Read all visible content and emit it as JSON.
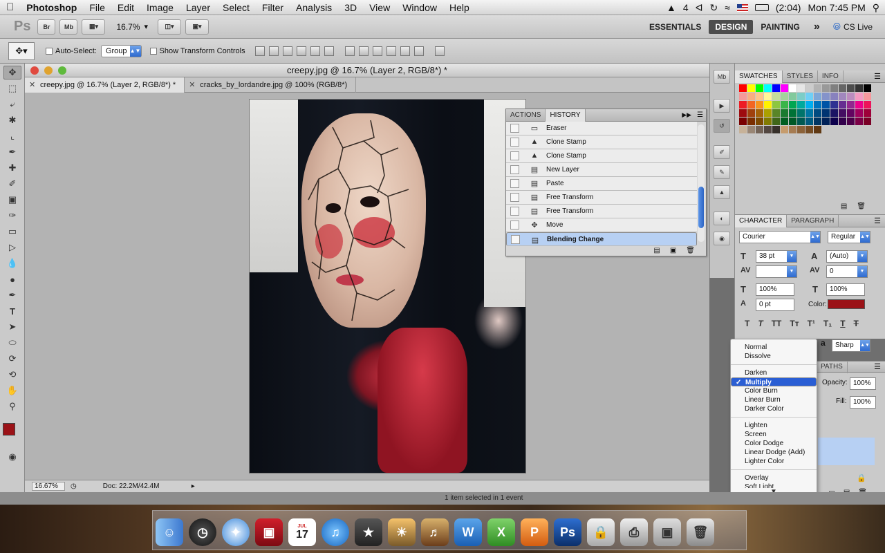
{
  "menubar": {
    "apple": "",
    "app": "Photoshop",
    "items": [
      "File",
      "Edit",
      "Image",
      "Layer",
      "Select",
      "Filter",
      "Analysis",
      "3D",
      "View",
      "Window",
      "Help"
    ],
    "right": {
      "ai": "4",
      "battery": "(2:04)",
      "clock": "Mon 7:45 PM"
    }
  },
  "appbar": {
    "logo": "Ps",
    "br": "Br",
    "mb": "Mb",
    "zoom": "16.7%",
    "workspaces": [
      "ESSENTIALS",
      "DESIGN",
      "PAINTING"
    ],
    "active_workspace": "DESIGN",
    "more": "»",
    "cslive": "CS Live"
  },
  "options": {
    "auto_select_label": "Auto-Select:",
    "auto_select_value": "Group",
    "show_transform": "Show Transform Controls"
  },
  "document": {
    "window_title": "creepy.jpg @ 16.7% (Layer 2, RGB/8*) *",
    "tabs": [
      {
        "label": "creepy.jpg @ 16.7% (Layer 2, RGB/8*) *"
      },
      {
        "label": "cracks_by_lordandre.jpg @ 100% (RGB/8*)"
      }
    ],
    "status_zoom": "16.67%",
    "status_doc": "Doc: 22.2M/42.4M",
    "strip_text": "1 item selected in 1 event"
  },
  "history": {
    "tabs": [
      "ACTIONS",
      "HISTORY"
    ],
    "active_tab": "HISTORY",
    "rows": [
      {
        "label": "Eraser",
        "icon": "eraser-icon"
      },
      {
        "label": "Clone Stamp",
        "icon": "stamp-icon"
      },
      {
        "label": "Clone Stamp",
        "icon": "stamp-icon"
      },
      {
        "label": "New Layer",
        "icon": "doc-icon"
      },
      {
        "label": "Paste",
        "icon": "doc-icon"
      },
      {
        "label": "Free Transform",
        "icon": "doc-icon"
      },
      {
        "label": "Free Transform",
        "icon": "doc-icon"
      },
      {
        "label": "Move",
        "icon": "move-icon"
      },
      {
        "label": "Blending Change",
        "icon": "doc-icon"
      }
    ],
    "selected_index": 8
  },
  "swatches": {
    "tabs": [
      "SWATCHES",
      "STYLES",
      "INFO"
    ],
    "colors": [
      "#ff0000",
      "#ffff00",
      "#00ff00",
      "#00ffff",
      "#0000ff",
      "#ff00ff",
      "#ffffff",
      "#e6e6e6",
      "#cccccc",
      "#b3b3b3",
      "#999999",
      "#808080",
      "#666666",
      "#4d4d4d",
      "#333333",
      "#000000",
      "#f5999a",
      "#f9ad81",
      "#fdc68a",
      "#fff799",
      "#c4df9b",
      "#a3d39c",
      "#82ca9d",
      "#7bcdc8",
      "#6ecff6",
      "#7ea7d8",
      "#8493ca",
      "#8882be",
      "#a187be",
      "#bc8cbf",
      "#f49ac2",
      "#f6989d",
      "#ed1c24",
      "#f26522",
      "#f7941d",
      "#fff200",
      "#8dc63f",
      "#39b54a",
      "#00a651",
      "#00a99d",
      "#00aeef",
      "#0072bc",
      "#0054a6",
      "#2e3192",
      "#662d91",
      "#92278f",
      "#ec008c",
      "#ed145b",
      "#9e0b0f",
      "#a0410d",
      "#a36209",
      "#aba000",
      "#598527",
      "#197b30",
      "#007236",
      "#00746b",
      "#0076a3",
      "#004b80",
      "#003471",
      "#1b1464",
      "#440e62",
      "#630460",
      "#9e005d",
      "#9e0039",
      "#790000",
      "#7b2e00",
      "#7d4900",
      "#827b00",
      "#406618",
      "#005e20",
      "#005826",
      "#005952",
      "#005b7f",
      "#003663",
      "#002157",
      "#0d004c",
      "#32004b",
      "#4b0049",
      "#7b0046",
      "#7a0026",
      "#c7b299",
      "#998675",
      "#736357",
      "#534741",
      "#37302a",
      "#c69c6d",
      "#a67c52",
      "#8c6239",
      "#754c24",
      "#603913"
    ]
  },
  "character": {
    "tabs": [
      "CHARACTER",
      "PARAGRAPH"
    ],
    "font_family": "Courier",
    "font_style": "Regular",
    "size": "38 pt",
    "leading": "(Auto)",
    "kerning": "",
    "tracking": "0",
    "vscale": "100%",
    "hscale": "100%",
    "baseline": "0 pt",
    "color_label": "Color:",
    "color": "#9b1217",
    "aa_label": "a",
    "aa_value": "Sharp"
  },
  "layers": {
    "tab": "PATHS",
    "opacity_label": "Opacity:",
    "opacity": "100%",
    "fill_label": "Fill:",
    "fill": "100%"
  },
  "blend_menu": {
    "groups": [
      [
        "Normal",
        "Dissolve"
      ],
      [
        "Darken",
        "Multiply",
        "Color Burn",
        "Linear Burn",
        "Darker Color"
      ],
      [
        "Lighten",
        "Screen",
        "Color Dodge",
        "Linear Dodge (Add)",
        "Lighter Color"
      ],
      [
        "Overlay",
        "Soft Light"
      ]
    ],
    "selected": "Multiply"
  },
  "foreground_color": "#9b1217",
  "dock": {
    "ps_label": "Ps",
    "cal_day": "17",
    "cal_month": "JUL"
  }
}
